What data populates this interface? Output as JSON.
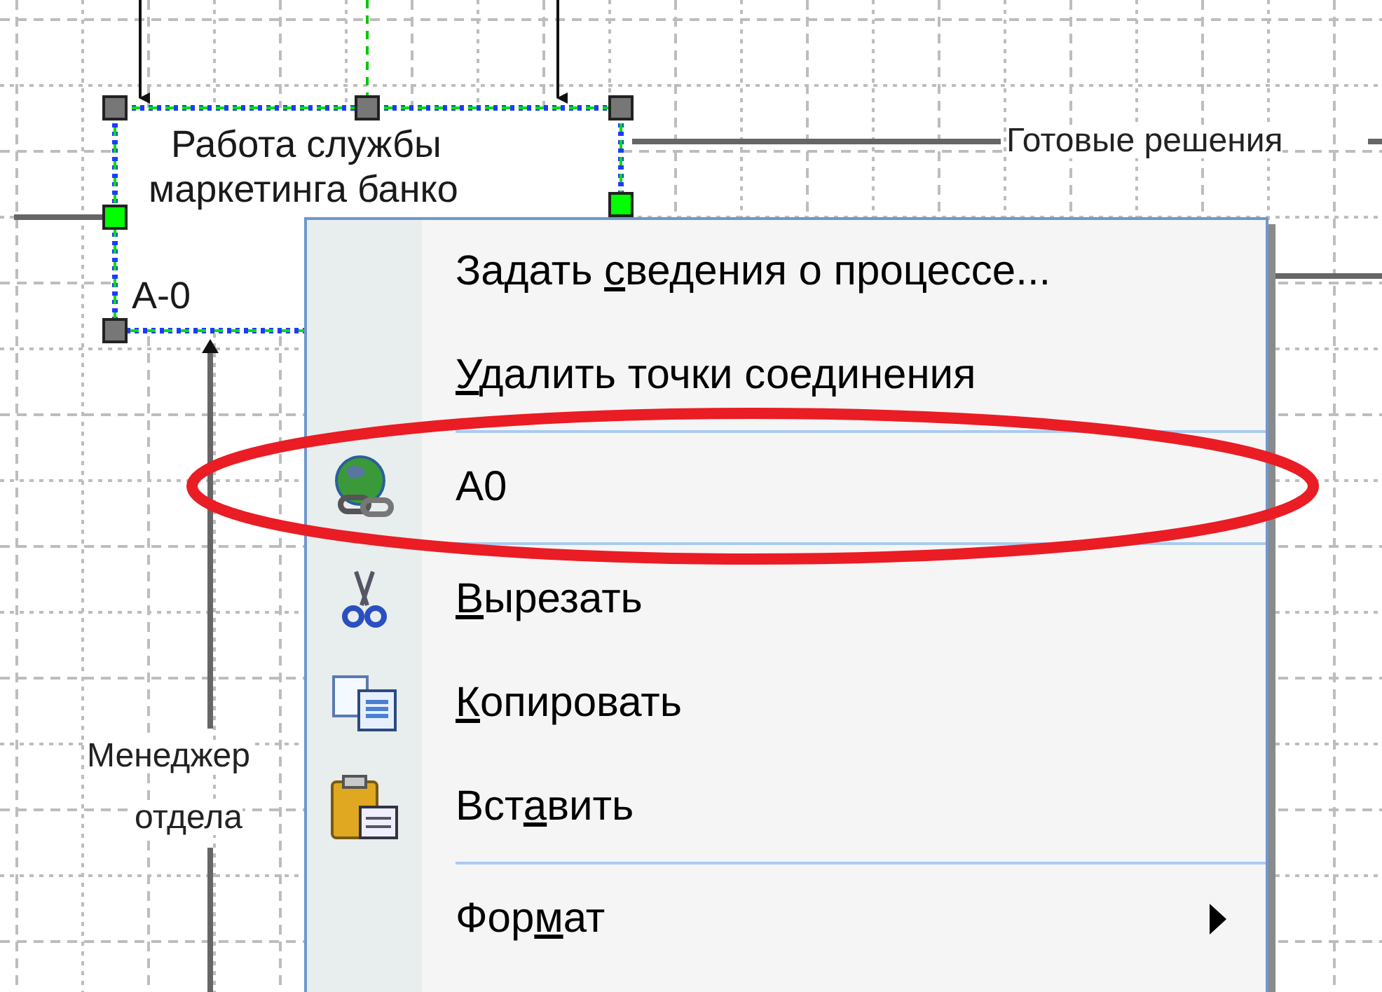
{
  "diagram": {
    "process_box": {
      "title_lines": [
        "Работа службы",
        "маркетинга банко"
      ],
      "code": "А-0"
    },
    "output_label": "Готовые решения",
    "mechanism_label": [
      "Менеджер",
      "отдела"
    ]
  },
  "context_menu": {
    "items": [
      {
        "kind": "text",
        "label": [
          {
            "text": "Задать ",
            "accelerator": false
          },
          {
            "text": "с",
            "accelerator": true
          },
          {
            "text": "ведения о процессе...",
            "accelerator": false
          }
        ]
      },
      {
        "kind": "text",
        "label": [
          {
            "text": "У",
            "accelerator": true
          },
          {
            "text": "далить точки соединения",
            "accelerator": false
          }
        ]
      },
      {
        "kind": "separator"
      },
      {
        "kind": "hyperlink",
        "label": [
          {
            "text": "А0",
            "accelerator": false
          }
        ]
      },
      {
        "kind": "separator"
      },
      {
        "kind": "cut",
        "label": [
          {
            "text": "В",
            "accelerator": true
          },
          {
            "text": "ырезать",
            "accelerator": false
          }
        ]
      },
      {
        "kind": "copy",
        "label": [
          {
            "text": "К",
            "accelerator": true
          },
          {
            "text": "опировать",
            "accelerator": false
          }
        ]
      },
      {
        "kind": "paste",
        "label": [
          {
            "text": "Вст",
            "accelerator": false
          },
          {
            "text": "а",
            "accelerator": true
          },
          {
            "text": "вить",
            "accelerator": false
          }
        ]
      },
      {
        "kind": "separator"
      },
      {
        "kind": "submenu",
        "label": [
          {
            "text": "Фор",
            "accelerator": false
          },
          {
            "text": "м",
            "accelerator": true
          },
          {
            "text": "ат",
            "accelerator": false
          }
        ]
      }
    ]
  },
  "annotation": {
    "kind": "ellipse"
  }
}
